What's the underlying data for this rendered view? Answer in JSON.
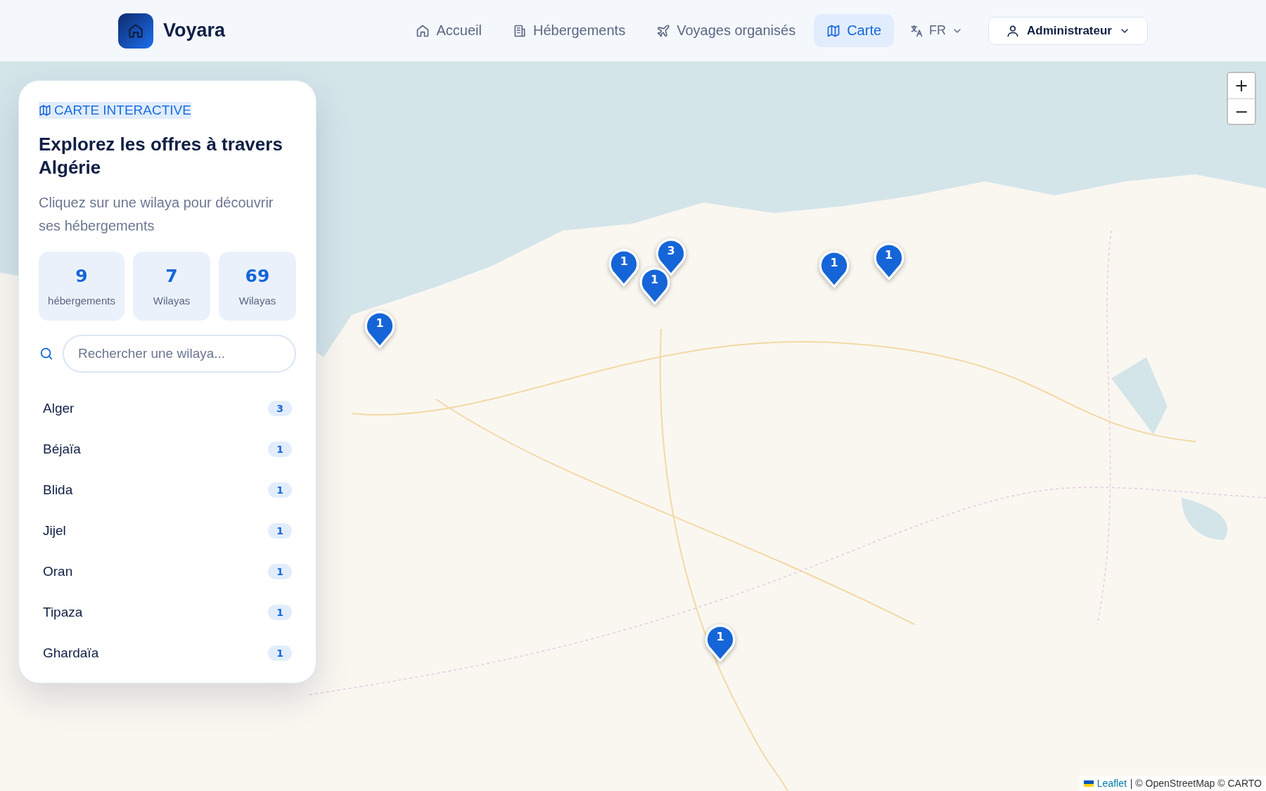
{
  "header": {
    "brand": "Voyara",
    "nav": [
      {
        "label": "Accueil",
        "selected": false
      },
      {
        "label": "Hébergements",
        "selected": false
      },
      {
        "label": "Voyages organisés",
        "selected": false
      },
      {
        "label": "Carte",
        "selected": true
      }
    ],
    "language": "FR",
    "user": "Administrateur"
  },
  "panel": {
    "eyebrow": "CARTE INTERACTIVE",
    "title": "Explorez les offres à travers Algérie",
    "subtitle": "Cliquez sur une wilaya pour découvrir ses hébergements",
    "stats": [
      {
        "value": "9",
        "label": "hébergements"
      },
      {
        "value": "7",
        "label": "Wilayas"
      },
      {
        "value": "69",
        "label": "Wilayas"
      }
    ],
    "search": {
      "placeholder": "Rechercher une wilaya..."
    },
    "wilayas": [
      {
        "name": "Alger",
        "count": "3"
      },
      {
        "name": "Béjaïa",
        "count": "1"
      },
      {
        "name": "Blida",
        "count": "1"
      },
      {
        "name": "Jijel",
        "count": "1"
      },
      {
        "name": "Oran",
        "count": "1"
      },
      {
        "name": "Tipaza",
        "count": "1"
      },
      {
        "name": "Ghardaïa",
        "count": "1"
      }
    ]
  },
  "map": {
    "zoom_in": "+",
    "zoom_out": "−",
    "markers": [
      {
        "count": "1"
      },
      {
        "count": "3"
      },
      {
        "count": "1"
      },
      {
        "count": "1"
      },
      {
        "count": "1"
      },
      {
        "count": "1"
      },
      {
        "count": "1"
      }
    ],
    "attribution": {
      "link": "Leaflet",
      "text": "| © OpenStreetMap © CARTO"
    }
  }
}
